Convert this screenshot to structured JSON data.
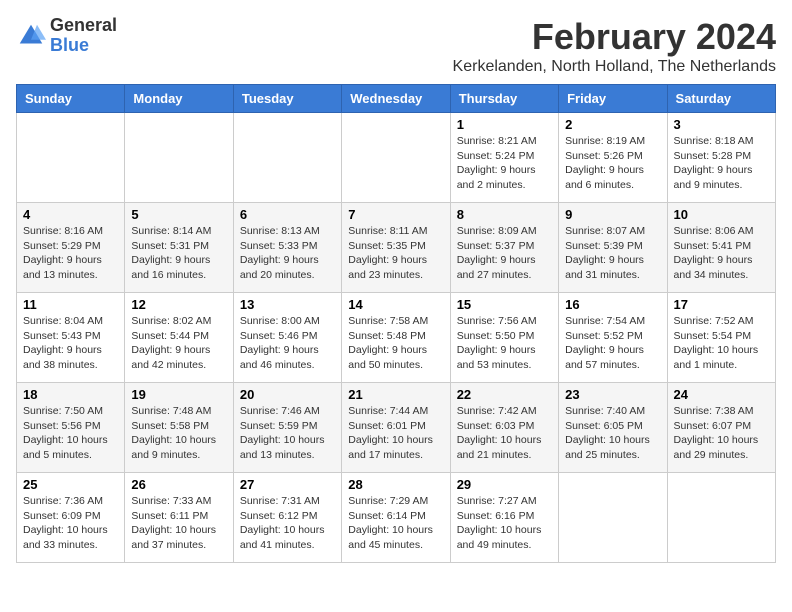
{
  "header": {
    "logo_general": "General",
    "logo_blue": "Blue",
    "title": "February 2024",
    "subtitle": "Kerkelanden, North Holland, The Netherlands"
  },
  "days_of_week": [
    "Sunday",
    "Monday",
    "Tuesday",
    "Wednesday",
    "Thursday",
    "Friday",
    "Saturday"
  ],
  "weeks": [
    [
      {
        "day": "",
        "info": ""
      },
      {
        "day": "",
        "info": ""
      },
      {
        "day": "",
        "info": ""
      },
      {
        "day": "",
        "info": ""
      },
      {
        "day": "1",
        "info": "Sunrise: 8:21 AM\nSunset: 5:24 PM\nDaylight: 9 hours and 2 minutes."
      },
      {
        "day": "2",
        "info": "Sunrise: 8:19 AM\nSunset: 5:26 PM\nDaylight: 9 hours and 6 minutes."
      },
      {
        "day": "3",
        "info": "Sunrise: 8:18 AM\nSunset: 5:28 PM\nDaylight: 9 hours and 9 minutes."
      }
    ],
    [
      {
        "day": "4",
        "info": "Sunrise: 8:16 AM\nSunset: 5:29 PM\nDaylight: 9 hours and 13 minutes."
      },
      {
        "day": "5",
        "info": "Sunrise: 8:14 AM\nSunset: 5:31 PM\nDaylight: 9 hours and 16 minutes."
      },
      {
        "day": "6",
        "info": "Sunrise: 8:13 AM\nSunset: 5:33 PM\nDaylight: 9 hours and 20 minutes."
      },
      {
        "day": "7",
        "info": "Sunrise: 8:11 AM\nSunset: 5:35 PM\nDaylight: 9 hours and 23 minutes."
      },
      {
        "day": "8",
        "info": "Sunrise: 8:09 AM\nSunset: 5:37 PM\nDaylight: 9 hours and 27 minutes."
      },
      {
        "day": "9",
        "info": "Sunrise: 8:07 AM\nSunset: 5:39 PM\nDaylight: 9 hours and 31 minutes."
      },
      {
        "day": "10",
        "info": "Sunrise: 8:06 AM\nSunset: 5:41 PM\nDaylight: 9 hours and 34 minutes."
      }
    ],
    [
      {
        "day": "11",
        "info": "Sunrise: 8:04 AM\nSunset: 5:43 PM\nDaylight: 9 hours and 38 minutes."
      },
      {
        "day": "12",
        "info": "Sunrise: 8:02 AM\nSunset: 5:44 PM\nDaylight: 9 hours and 42 minutes."
      },
      {
        "day": "13",
        "info": "Sunrise: 8:00 AM\nSunset: 5:46 PM\nDaylight: 9 hours and 46 minutes."
      },
      {
        "day": "14",
        "info": "Sunrise: 7:58 AM\nSunset: 5:48 PM\nDaylight: 9 hours and 50 minutes."
      },
      {
        "day": "15",
        "info": "Sunrise: 7:56 AM\nSunset: 5:50 PM\nDaylight: 9 hours and 53 minutes."
      },
      {
        "day": "16",
        "info": "Sunrise: 7:54 AM\nSunset: 5:52 PM\nDaylight: 9 hours and 57 minutes."
      },
      {
        "day": "17",
        "info": "Sunrise: 7:52 AM\nSunset: 5:54 PM\nDaylight: 10 hours and 1 minute."
      }
    ],
    [
      {
        "day": "18",
        "info": "Sunrise: 7:50 AM\nSunset: 5:56 PM\nDaylight: 10 hours and 5 minutes."
      },
      {
        "day": "19",
        "info": "Sunrise: 7:48 AM\nSunset: 5:58 PM\nDaylight: 10 hours and 9 minutes."
      },
      {
        "day": "20",
        "info": "Sunrise: 7:46 AM\nSunset: 5:59 PM\nDaylight: 10 hours and 13 minutes."
      },
      {
        "day": "21",
        "info": "Sunrise: 7:44 AM\nSunset: 6:01 PM\nDaylight: 10 hours and 17 minutes."
      },
      {
        "day": "22",
        "info": "Sunrise: 7:42 AM\nSunset: 6:03 PM\nDaylight: 10 hours and 21 minutes."
      },
      {
        "day": "23",
        "info": "Sunrise: 7:40 AM\nSunset: 6:05 PM\nDaylight: 10 hours and 25 minutes."
      },
      {
        "day": "24",
        "info": "Sunrise: 7:38 AM\nSunset: 6:07 PM\nDaylight: 10 hours and 29 minutes."
      }
    ],
    [
      {
        "day": "25",
        "info": "Sunrise: 7:36 AM\nSunset: 6:09 PM\nDaylight: 10 hours and 33 minutes."
      },
      {
        "day": "26",
        "info": "Sunrise: 7:33 AM\nSunset: 6:11 PM\nDaylight: 10 hours and 37 minutes."
      },
      {
        "day": "27",
        "info": "Sunrise: 7:31 AM\nSunset: 6:12 PM\nDaylight: 10 hours and 41 minutes."
      },
      {
        "day": "28",
        "info": "Sunrise: 7:29 AM\nSunset: 6:14 PM\nDaylight: 10 hours and 45 minutes."
      },
      {
        "day": "29",
        "info": "Sunrise: 7:27 AM\nSunset: 6:16 PM\nDaylight: 10 hours and 49 minutes."
      },
      {
        "day": "",
        "info": ""
      },
      {
        "day": "",
        "info": ""
      }
    ]
  ]
}
